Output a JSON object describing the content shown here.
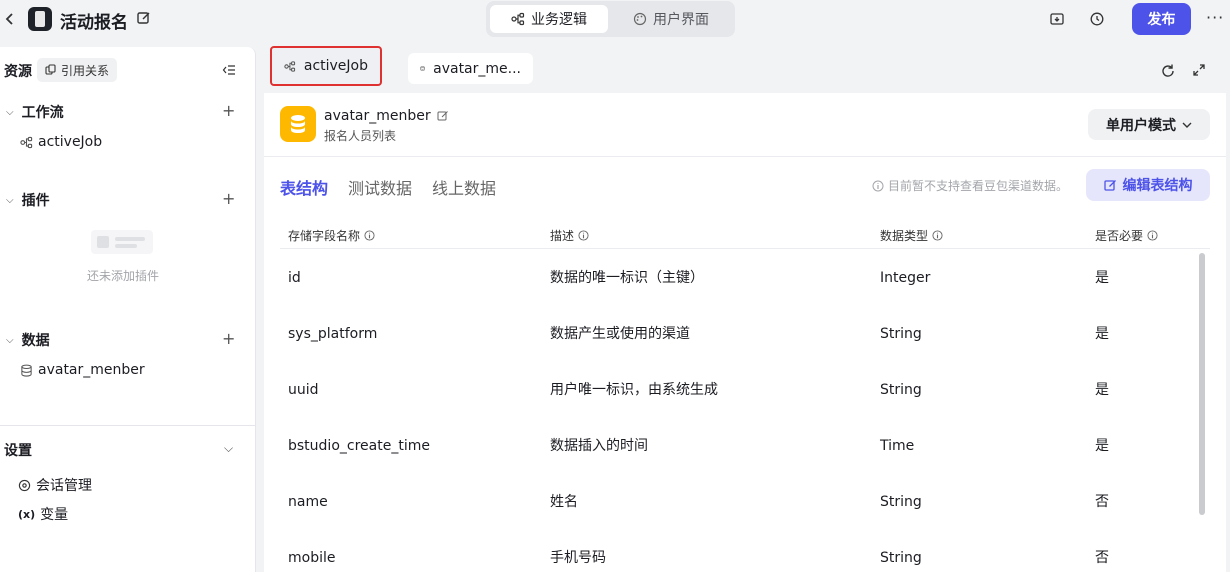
{
  "header": {
    "app_title": "活动报名",
    "modes": [
      "业务逻辑",
      "用户界面"
    ],
    "publish_label": "发布"
  },
  "sidebar": {
    "resources_label": "资源",
    "references_label": "引用关系",
    "workflow": {
      "title": "工作流",
      "items": [
        "activeJob"
      ]
    },
    "plugins": {
      "title": "插件",
      "empty_text": "还未添加插件"
    },
    "data": {
      "title": "数据",
      "items": [
        "avatar_menber"
      ]
    },
    "settings": {
      "title": "设置",
      "items": [
        "会话管理",
        "变量"
      ],
      "variable_prefix": "(x)"
    }
  },
  "tabs": [
    "activeJob",
    "avatar_me..."
  ],
  "table_header": {
    "name": "avatar_menber",
    "description": "报名人员列表",
    "mode_label": "单用户模式"
  },
  "subtabs": [
    "表结构",
    "测试数据",
    "线上数据"
  ],
  "notice": "目前暂不支持查看豆包渠道数据。",
  "edit_schema_label": "编辑表结构",
  "columns": [
    "存储字段名称",
    "描述",
    "数据类型",
    "是否必要"
  ],
  "rows": [
    [
      "id",
      "数据的唯一标识（主键）",
      "Integer",
      "是"
    ],
    [
      "sys_platform",
      "数据产生或使用的渠道",
      "String",
      "是"
    ],
    [
      "uuid",
      "用户唯一标识，由系统生成",
      "String",
      "是"
    ],
    [
      "bstudio_create_time",
      "数据插入的时间",
      "Time",
      "是"
    ],
    [
      "name",
      "姓名",
      "String",
      "否"
    ],
    [
      "mobile",
      "手机号码",
      "String",
      "否"
    ]
  ],
  "colors": {
    "accent": "#4d53e8",
    "db_icon": "#ffb800",
    "highlight_border": "#e03131"
  }
}
